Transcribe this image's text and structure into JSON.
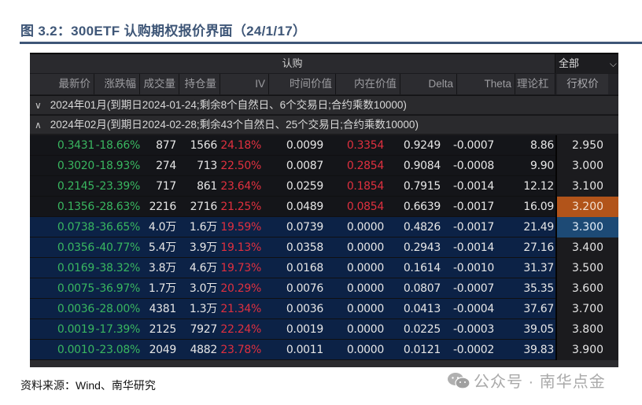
{
  "figure": {
    "title": "图 3.2：300ETF 认购期权报价界面（24/1/17）",
    "source": "资料来源：Wind、南华研究",
    "watermark": "公众号 · 南华点金"
  },
  "panel": {
    "group_label": "认购",
    "filter_select": {
      "value": "全部",
      "icon": "chevron-down-icon"
    },
    "columns": [
      "最新价",
      "涨跌幅",
      "成交量",
      "持仓量",
      "IV",
      "时间价值",
      "内在价值",
      "Delta",
      "Theta",
      "理论杠杆",
      "行权价"
    ],
    "column_visible_labels": [
      "最新价",
      "涨跌幅",
      "成交量",
      "持仓量",
      "IV",
      "时间价值",
      "内在价值",
      "Delta",
      "Theta",
      "理论杠",
      "行权价"
    ],
    "months": [
      {
        "arrow": "⌄",
        "expanded": false,
        "label": "2024年01月(到期日2024-01-24;剩余8个自然日、6个交易日;合约乘数10000)"
      },
      {
        "arrow": "⌃",
        "expanded": true,
        "label": "2024年02月(到期日2024-02-28;剩余43个自然日、25个交易日;合约乘数10000)"
      }
    ],
    "rows": [
      {
        "last": "0.3431",
        "chg": "-18.66%",
        "vol": "877",
        "oi": "1566",
        "iv": "24.18%",
        "time_value": "0.0099",
        "intrinsic": "0.3354",
        "delta": "0.9249",
        "theta": "-0.0007",
        "leverage": "8.86",
        "strike": "2.950",
        "moneyness": "itm"
      },
      {
        "last": "0.3020",
        "chg": "-18.93%",
        "vol": "274",
        "oi": "713",
        "iv": "22.50%",
        "time_value": "0.0087",
        "intrinsic": "0.2854",
        "delta": "0.9084",
        "theta": "-0.0008",
        "leverage": "9.90",
        "strike": "3.000",
        "moneyness": "itm"
      },
      {
        "last": "0.2145",
        "chg": "-23.39%",
        "vol": "717",
        "oi": "861",
        "iv": "23.64%",
        "time_value": "0.0259",
        "intrinsic": "0.1854",
        "delta": "0.7915",
        "theta": "-0.0014",
        "leverage": "12.12",
        "strike": "3.100",
        "moneyness": "itm"
      },
      {
        "last": "0.1356",
        "chg": "-28.63%",
        "vol": "2216",
        "oi": "2716",
        "iv": "21.25%",
        "time_value": "0.0489",
        "intrinsic": "0.0854",
        "delta": "0.6639",
        "theta": "-0.0017",
        "leverage": "16.09",
        "strike": "3.200",
        "moneyness": "itm",
        "strike_state": "atm"
      },
      {
        "last": "0.0738",
        "chg": "-36.65%",
        "vol": "4.0万",
        "oi": "1.6万",
        "iv": "19.59%",
        "time_value": "0.0739",
        "intrinsic": "0.0000",
        "delta": "0.4826",
        "theta": "-0.0017",
        "leverage": "21.49",
        "strike": "3.300",
        "moneyness": "otm",
        "strike_state": "selected"
      },
      {
        "last": "0.0356",
        "chg": "-40.77%",
        "vol": "5.4万",
        "oi": "3.9万",
        "iv": "19.13%",
        "time_value": "0.0358",
        "intrinsic": "0.0000",
        "delta": "0.2943",
        "theta": "-0.0014",
        "leverage": "27.16",
        "strike": "3.400",
        "moneyness": "otm"
      },
      {
        "last": "0.0169",
        "chg": "-38.32%",
        "vol": "3.8万",
        "oi": "4.6万",
        "iv": "19.73%",
        "time_value": "0.0168",
        "intrinsic": "0.0000",
        "delta": "0.1614",
        "theta": "-0.0010",
        "leverage": "31.37",
        "strike": "3.500",
        "moneyness": "otm"
      },
      {
        "last": "0.0075",
        "chg": "-36.97%",
        "vol": "1.7万",
        "oi": "3.0万",
        "iv": "20.29%",
        "time_value": "0.0076",
        "intrinsic": "0.0000",
        "delta": "0.0807",
        "theta": "-0.0007",
        "leverage": "35.35",
        "strike": "3.600",
        "moneyness": "otm"
      },
      {
        "last": "0.0036",
        "chg": "-28.00%",
        "vol": "4381",
        "oi": "1.3万",
        "iv": "21.34%",
        "time_value": "0.0036",
        "intrinsic": "0.0000",
        "delta": "0.0413",
        "theta": "-0.0004",
        "leverage": "37.67",
        "strike": "3.700",
        "moneyness": "otm"
      },
      {
        "last": "0.0019",
        "chg": "-17.39%",
        "vol": "2125",
        "oi": "7927",
        "iv": "22.24%",
        "time_value": "0.0019",
        "intrinsic": "0.0000",
        "delta": "0.0225",
        "theta": "-0.0003",
        "leverage": "39.05",
        "strike": "3.800",
        "moneyness": "otm"
      },
      {
        "last": "0.0010",
        "chg": "-23.08%",
        "vol": "2049",
        "oi": "4882",
        "iv": "23.78%",
        "time_value": "0.0011",
        "intrinsic": "0.0000",
        "delta": "0.0121",
        "theta": "-0.0002",
        "leverage": "39.83",
        "strike": "3.900",
        "moneyness": "otm"
      }
    ]
  },
  "colors": {
    "title": "#3e5677",
    "up_red": "#e0303f",
    "down_green": "#39b660",
    "otm_row_bg": "#0c2246",
    "atm_strike_bg": "#b2541a",
    "selected_strike_bg": "#1d4a75"
  }
}
